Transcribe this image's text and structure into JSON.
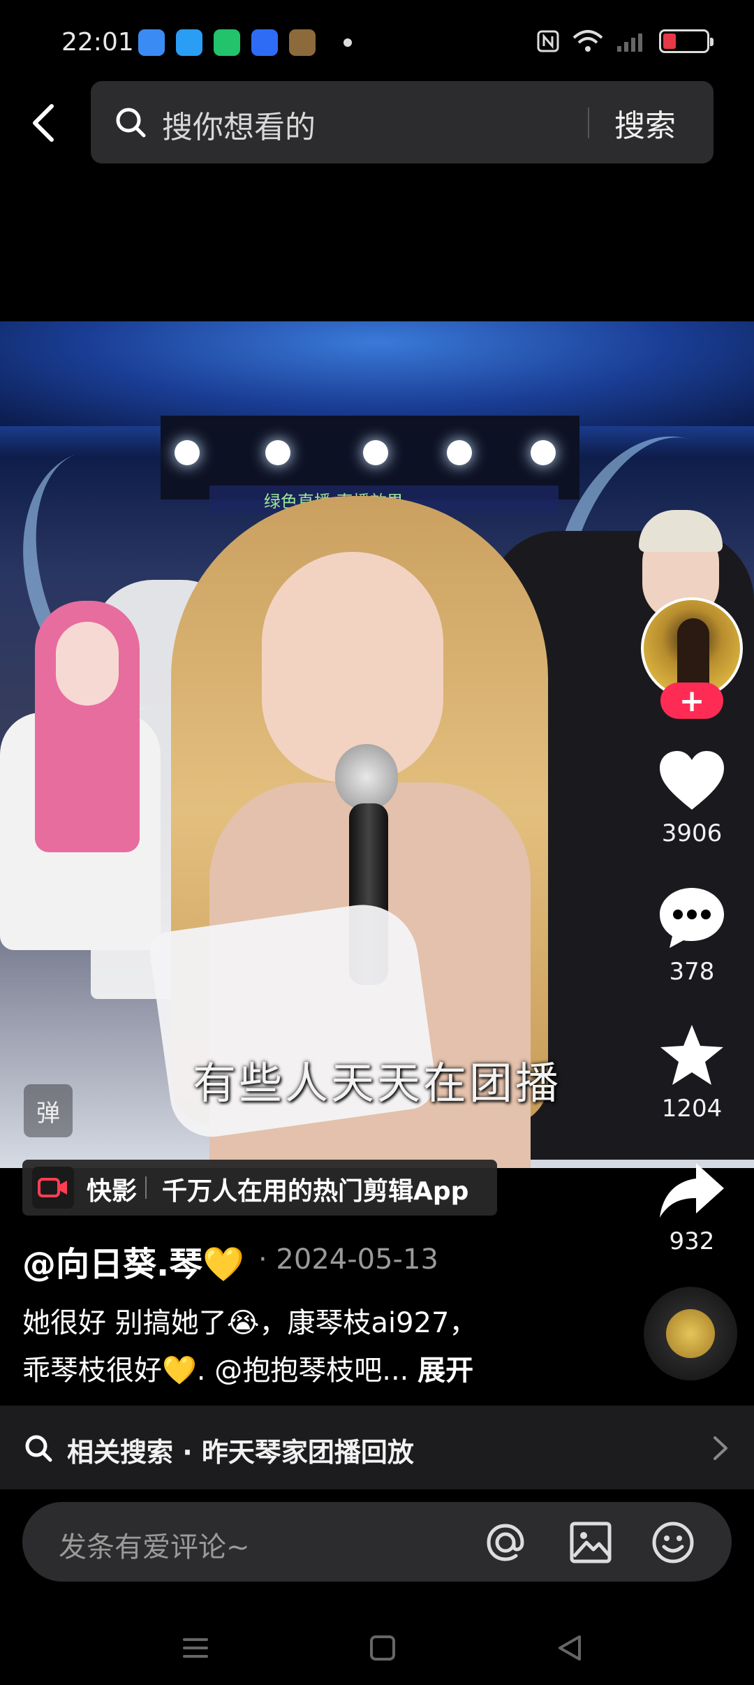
{
  "status_bar": {
    "time": "22:01",
    "app_icons": [
      {
        "name": "weather-app-icon",
        "color": "#3b8bf5"
      },
      {
        "name": "browser-app-icon",
        "color": "#2a9df4"
      },
      {
        "name": "battery-app-icon",
        "color": "#22c36b"
      },
      {
        "name": "baidu-app-icon",
        "color": "#2f6cf5"
      },
      {
        "name": "game-app-icon",
        "color": "#8c6a3b"
      }
    ],
    "battery_level": 0.2,
    "battery_color": "#e53947"
  },
  "search": {
    "placeholder": "搜你想看的",
    "button_label": "搜索"
  },
  "video": {
    "stage_text": "绿色直播 直播效果",
    "subtitle": "有些人天天在团播",
    "watermark_tag": "弹"
  },
  "side_rail": {
    "follow_symbol": "+",
    "likes": "3906",
    "comments": "378",
    "favorites": "1204",
    "shares": "932"
  },
  "ad": {
    "brand": "快影",
    "text": "千万人在用的热门剪辑App"
  },
  "post": {
    "author": "@向日葵.琴💛",
    "date": "· 2024-05-13",
    "caption_line1": "她很好 别搞她了😭，康琴枝ai927，",
    "caption_line2": "乖琴枝很好💛. @抱抱琴枝吧...",
    "expand_label": "展开"
  },
  "related": {
    "text": "相关搜索 · 昨天琴家团播回放"
  },
  "comment": {
    "placeholder": "发条有爱评论~"
  },
  "colors": {
    "accent": "#fe2c55",
    "background": "#000000",
    "panel": "#2c2c2e"
  }
}
